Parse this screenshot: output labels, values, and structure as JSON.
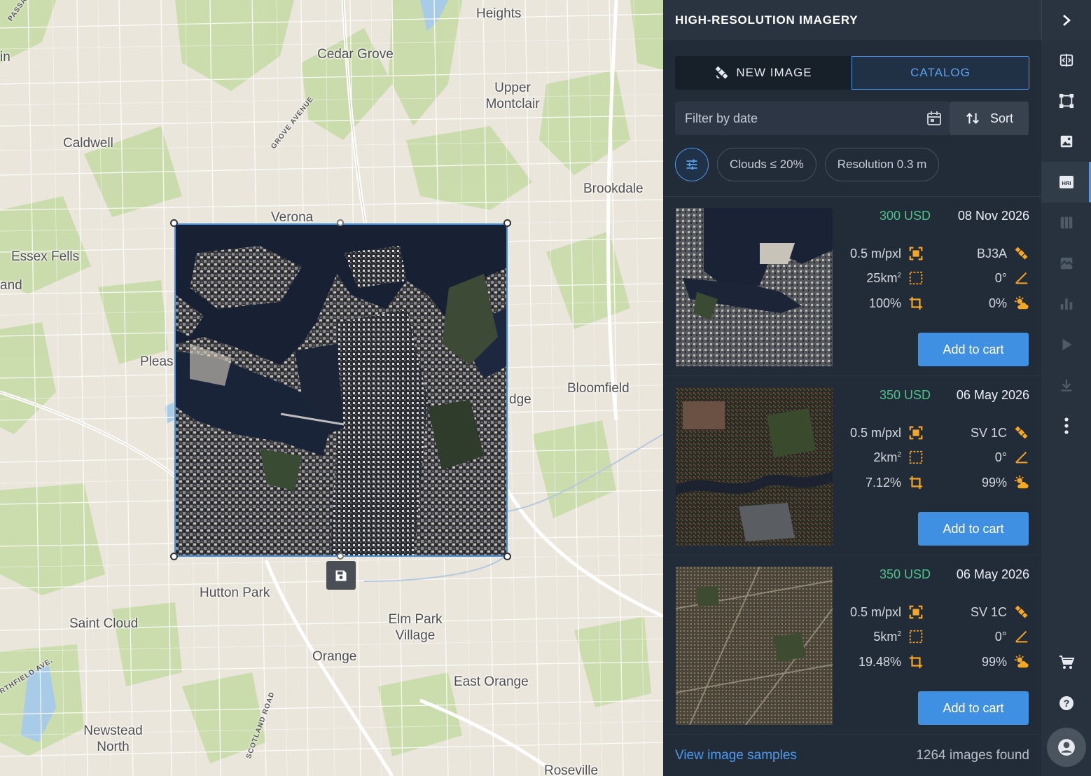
{
  "map": {
    "labels": {
      "heights": "Heights",
      "cedar_grove": "Cedar Grove",
      "upper_montclair": "Upper Montclair",
      "caldwell": "Caldwell",
      "brookdale": "Brookdale",
      "verona": "Verona",
      "essex_fells": "Essex Fells",
      "pleas": "Pleas",
      "bloomfield": "Bloomfield",
      "dge": "dge",
      "hutton_park": "Hutton Park",
      "saint_cloud": "Saint Cloud",
      "elm_park_village": "Elm Park Village",
      "orange": "Orange",
      "east_orange": "East Orange",
      "newstead_north": "Newstead North",
      "roseville": "Roseville",
      "in": "in",
      "and": "and",
      "grove_avenue": "GROVE AVENUE",
      "passaic": "PASSA",
      "scotland_road": "SCOTLAND ROAD",
      "northfield_ave": "RTHFIELD AVE."
    }
  },
  "panel": {
    "title": "HIGH-RESOLUTION IMAGERY",
    "tabs": {
      "new_image": "NEW IMAGE",
      "catalog": "CATALOG"
    },
    "filter_date_placeholder": "Filter by date",
    "sort_label": "Sort",
    "chips": {
      "clouds": "Clouds ≤ 20%",
      "resolution": "Resolution 0.3 m"
    },
    "results": [
      {
        "price": "300 USD",
        "date": "08 Nov 2026",
        "resolution": "0.5 m/pxl",
        "satellite": "BJ3A",
        "area": "25km",
        "angle": "0°",
        "coverage": "100%",
        "clouds": "0%",
        "add_label": "Add to cart"
      },
      {
        "price": "350 USD",
        "date": "06 May 2026",
        "resolution": "0.5 m/pxl",
        "satellite": "SV 1C",
        "area": "2km",
        "angle": "0°",
        "coverage": "7.12%",
        "clouds": "99%",
        "add_label": "Add to cart"
      },
      {
        "price": "350 USD",
        "date": "06 May 2026",
        "resolution": "0.5 m/pxl",
        "satellite": "SV 1C",
        "area": "5km",
        "angle": "0°",
        "coverage": "19.48%",
        "clouds": "99%",
        "add_label": "Add to cart"
      }
    ],
    "area_superscript": "2",
    "footer": {
      "samples_link": "View image samples",
      "found_count": "1264",
      "found_suffix": "images found"
    }
  },
  "toolbar": {
    "items": [
      "compare-icon",
      "polygon-icon",
      "image-icon",
      "hri-icon",
      "map-layers-icon",
      "satellite-image-icon",
      "bar-chart-icon",
      "play-icon",
      "download-icon",
      "more-vertical-icon",
      "cart-icon",
      "help-icon",
      "account-icon"
    ],
    "hri_badge": "HRI"
  },
  "colors": {
    "accent": "#3f8fe3",
    "price_green": "#4cc38a",
    "icon_orange": "#f5a623",
    "panel_bg": "#222c38"
  }
}
